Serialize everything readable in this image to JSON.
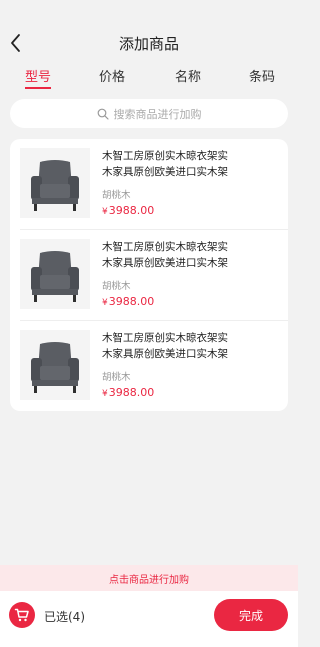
{
  "header": {
    "title": "添加商品"
  },
  "tabs": [
    {
      "label": "型号",
      "active": true
    },
    {
      "label": "价格",
      "active": false
    },
    {
      "label": "名称",
      "active": false
    },
    {
      "label": "条码",
      "active": false
    }
  ],
  "search": {
    "placeholder": "搜索商品进行加购",
    "icon": "search-icon"
  },
  "products": [
    {
      "title_line1": "木智工房原创实木晾衣架实",
      "title_line2": "木家具原创欧美进口实木架",
      "material": "胡桃木",
      "currency": "¥",
      "price": "3988.00"
    },
    {
      "title_line1": "木智工房原创实木晾衣架实",
      "title_line2": "木家具原创欧美进口实木架",
      "material": "胡桃木",
      "currency": "¥",
      "price": "3988.00"
    },
    {
      "title_line1": "木智工房原创实木晾衣架实",
      "title_line2": "木家具原创欧美进口实木架",
      "material": "胡桃木",
      "currency": "¥",
      "price": "3988.00"
    }
  ],
  "hint": "点击商品进行加购",
  "footer": {
    "selected": "已选(4)",
    "done": "完成"
  },
  "colors": {
    "accent": "#ea2742",
    "background": "#f2f2f2"
  }
}
